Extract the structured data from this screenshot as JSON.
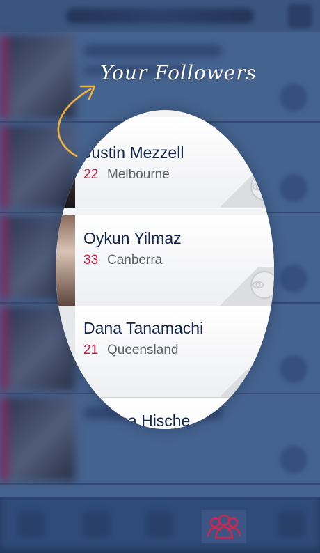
{
  "overlay": {
    "title": "Your Followers"
  },
  "followers": [
    {
      "name": "Justin Mezzell",
      "age": "22",
      "city": "Melbourne"
    },
    {
      "name": "Oykun Yilmaz",
      "age": "33",
      "city": "Canberra"
    },
    {
      "name": "Dana Tanamachi",
      "age": "21",
      "city": "Queensland"
    },
    {
      "name": "Jessica Hische",
      "age": "",
      "city": ""
    }
  ],
  "icons": {
    "arrow": "curved-arrow-icon",
    "eye": "eye-icon",
    "followers_tab": "followers-group-icon"
  },
  "colors": {
    "background": "#3c5a86",
    "accent": "#c8163c",
    "name_text": "#13254d",
    "arrow": "#f2b33d"
  }
}
